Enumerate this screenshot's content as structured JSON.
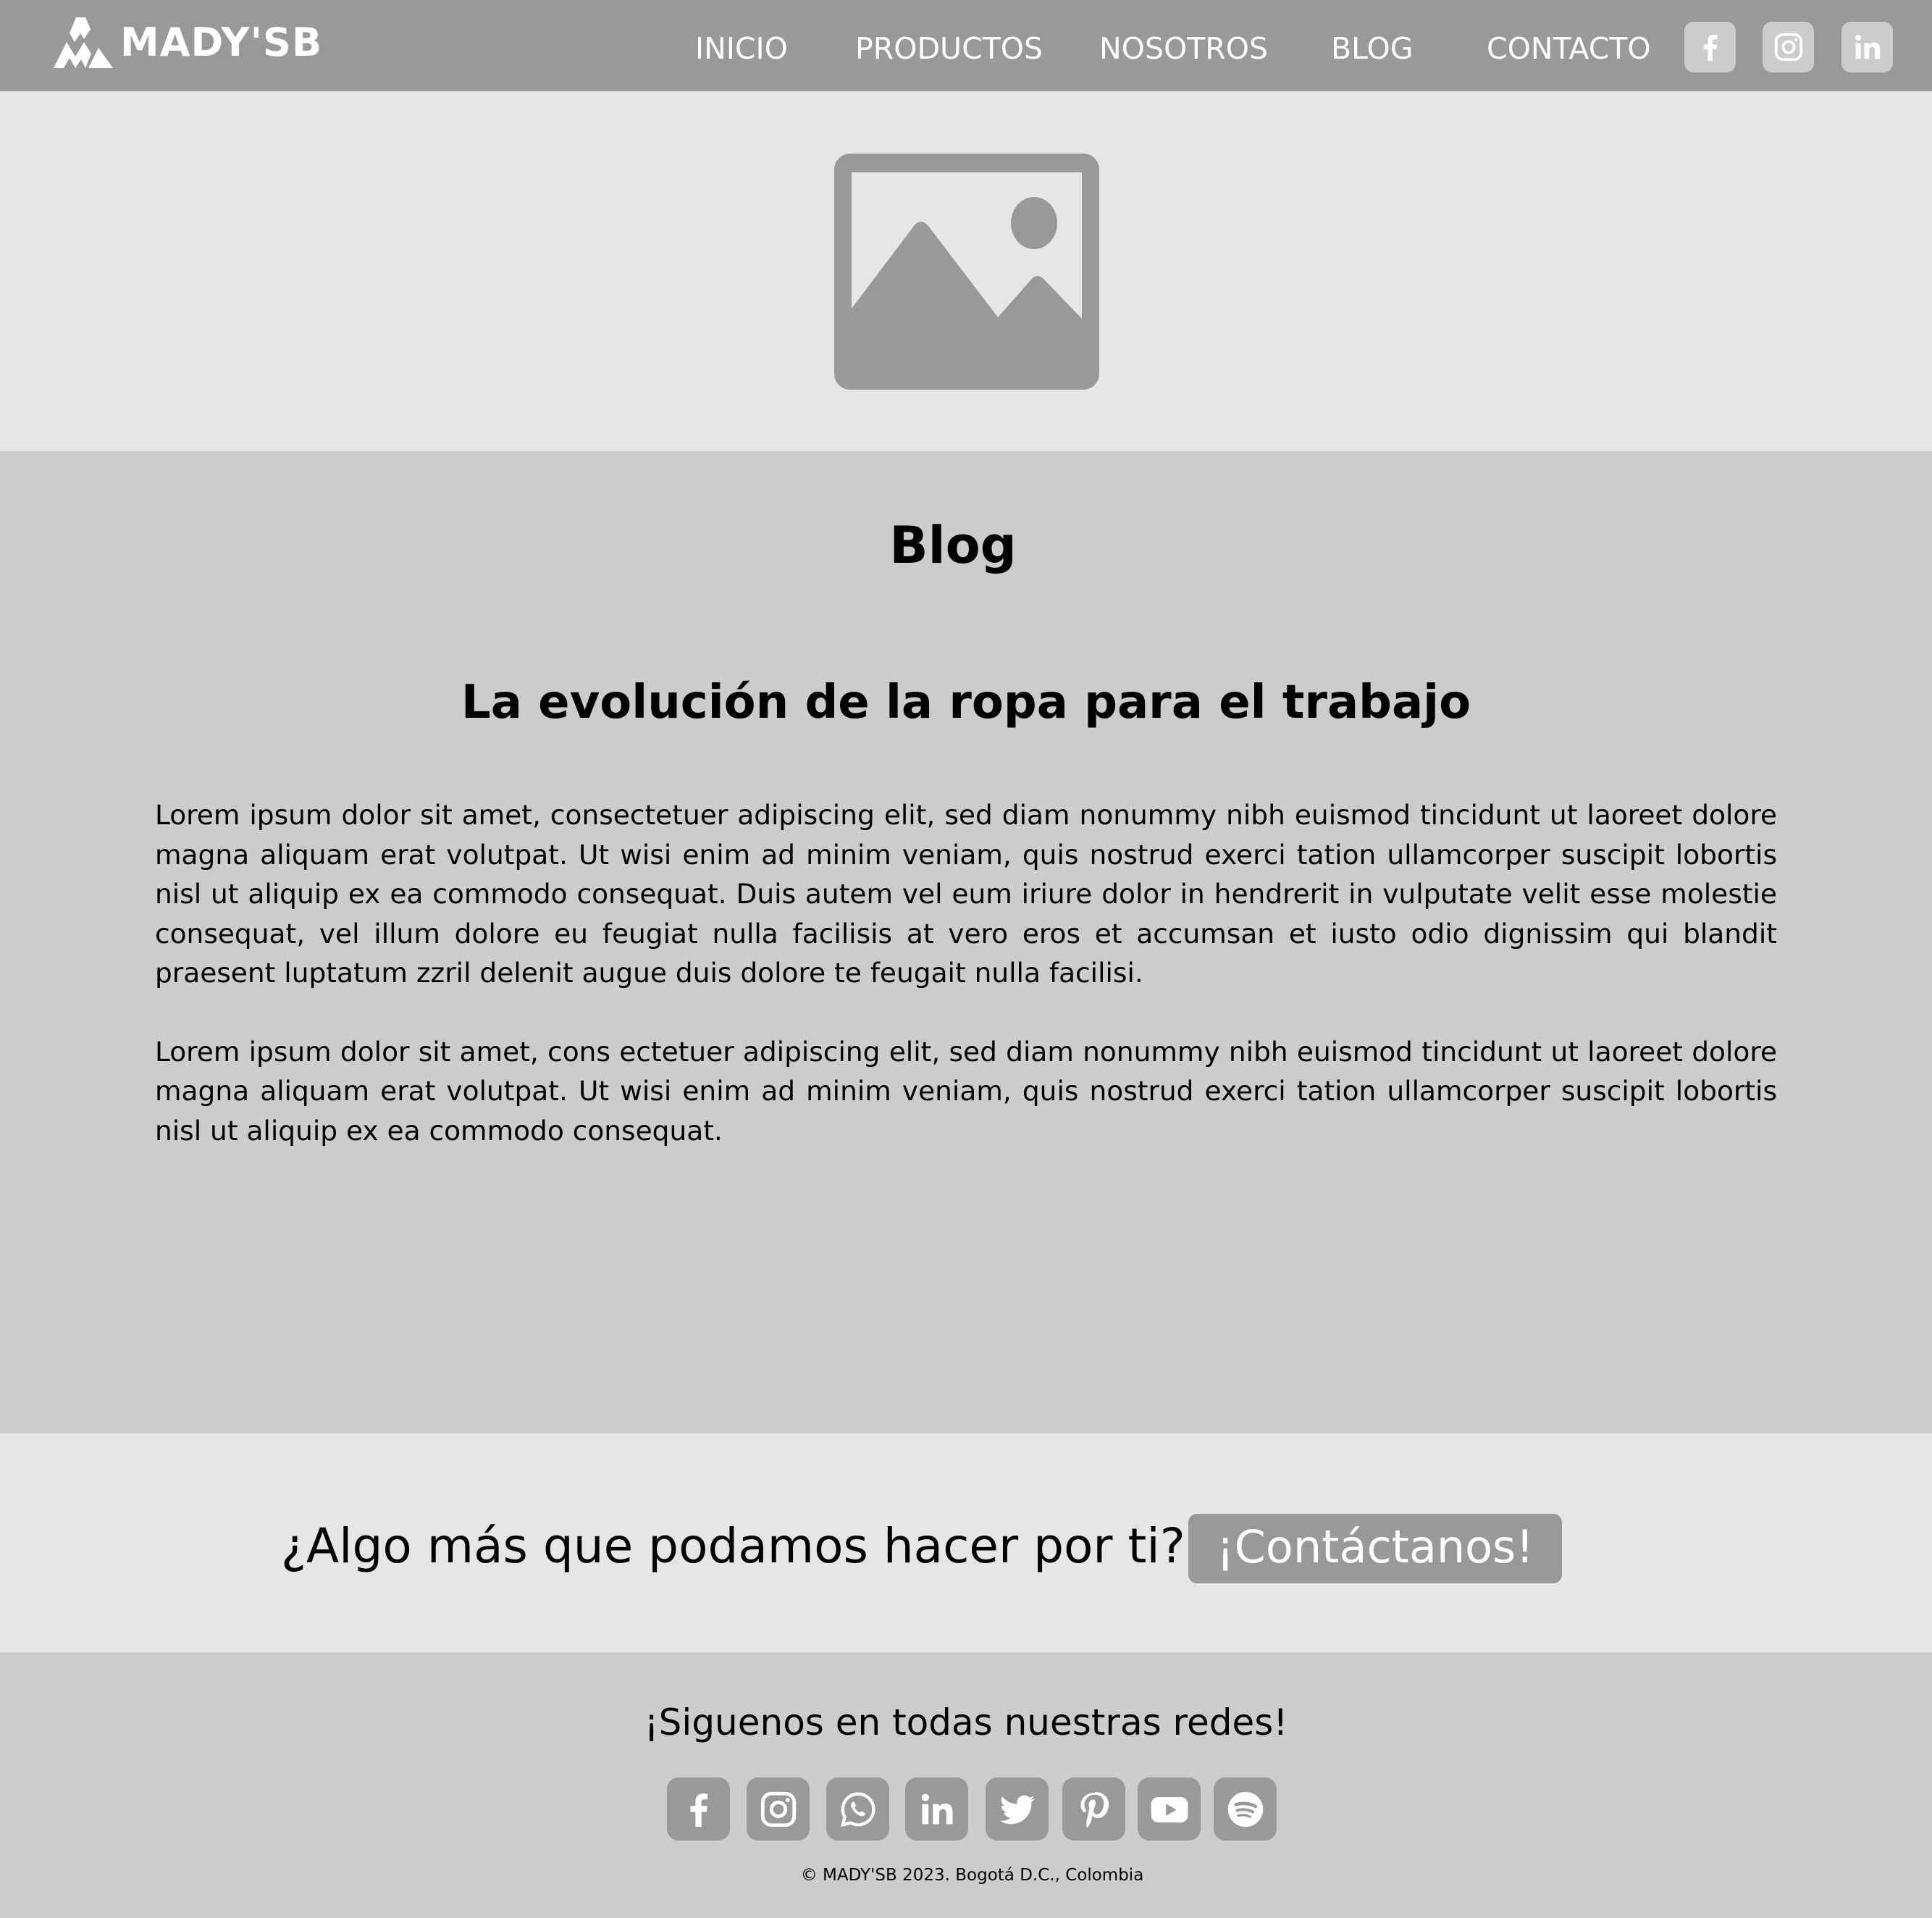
{
  "brand": {
    "name": "MADY'SB",
    "logo_icon": "mountain-logo-icon",
    "colors": {
      "header": "#999999",
      "light_band": "#e6e6e6",
      "mid_band": "#cccccc",
      "text": "#000000",
      "inverse_text": "#ffffff"
    }
  },
  "nav": {
    "items": [
      {
        "label": "INICIO"
      },
      {
        "label": "PRODUCTOS"
      },
      {
        "label": "NOSOTROS"
      },
      {
        "label": "BLOG"
      },
      {
        "label": "CONTACTO"
      }
    ],
    "social_icons": [
      "facebook-icon",
      "instagram-icon",
      "linkedin-icon"
    ]
  },
  "hero": {
    "image_icon": "image-placeholder-icon"
  },
  "blog": {
    "section_title": "Blog",
    "post_title": "La evolución de la ropa para el trabajo",
    "paragraphs": [
      "Lorem ipsum dolor sit amet, consectetuer adipiscing elit, sed diam nonummy nibh euismod tincidunt ut laoreet dolore magna aliquam erat volutpat. Ut wisi enim ad minim veniam, quis nostrud exerci tation ullamcorper suscipit lobortis nisl ut aliquip ex ea commodo consequat. Duis autem vel eum iriure dolor in hendrerit in vulputate velit esse molestie con­sequat, vel illum dolore eu feugiat nulla facilisis at vero eros et accumsan et iusto odio dignissim qui blandit praesent lup­tatum zzril delenit augue duis dolore te feugait nulla facilisi.",
      "Lorem ipsum dolor sit amet, cons ectetuer adipiscing elit, sed diam nonummy nibh euismod tincidunt ut laoreet dolore magna aliquam erat volutpat. Ut wisi enim ad minim veniam, quis nostrud exerci tation ullamcorper suscipit lobortis nisl ut aliquip ex ea commodo consequat."
    ]
  },
  "cta": {
    "question": "¿Algo más que podamos hacer por ti?",
    "button_label": "¡Contáctanos!"
  },
  "footer": {
    "follow_text": "¡Siguenos en todas nuestras redes!",
    "social_icons": [
      "facebook-icon",
      "instagram-icon",
      "whatsapp-icon",
      "linkedin-icon",
      "twitter-icon",
      "pinterest-icon",
      "youtube-icon",
      "spotify-icon"
    ],
    "copyright": "© MADY'SB 2023. Bogotá D.C., Colombia"
  }
}
